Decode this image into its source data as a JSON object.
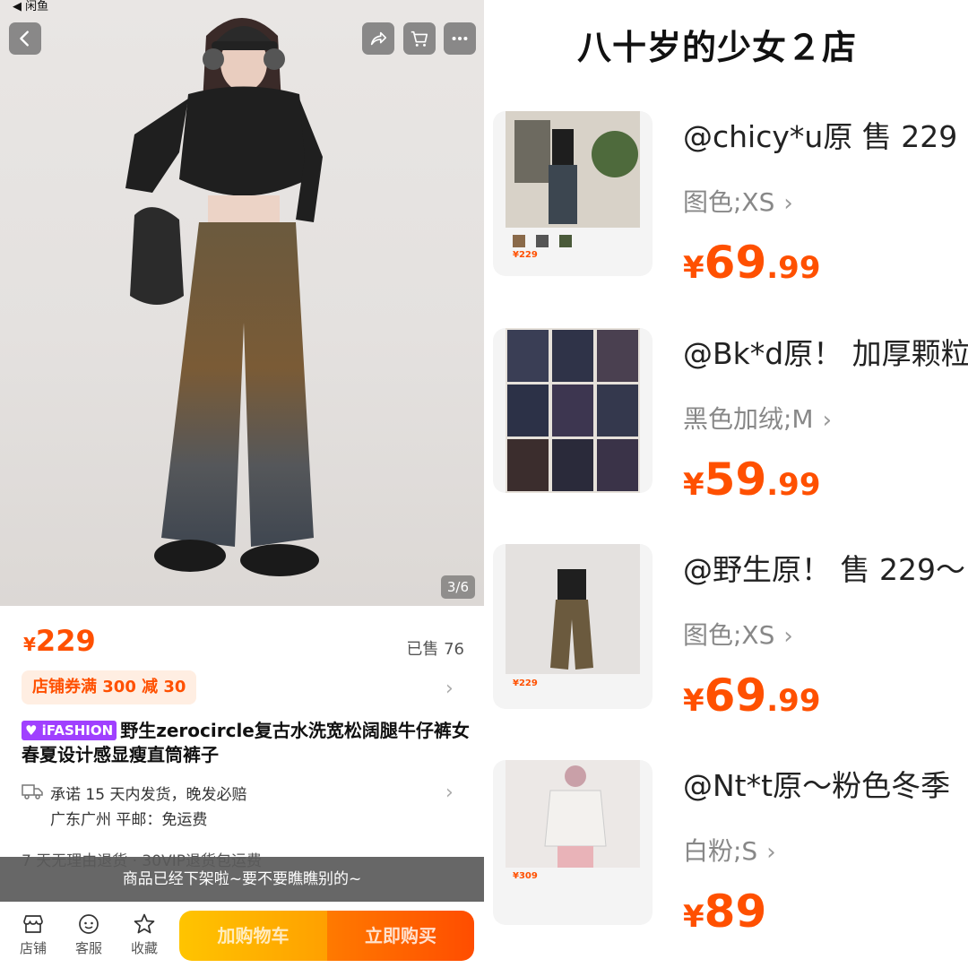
{
  "status_bar": {
    "back_app": "◀ 闲鱼"
  },
  "product": {
    "image_counter": "3/6",
    "price_currency": "¥",
    "price": "229",
    "sold": "已售 76",
    "coupon": "店铺券满 300 减 30",
    "badge": "iFASHION",
    "title": "野生zerocircle复古水洗宽松阔腿牛仔裤女春夏设计感显瘦直筒裤子",
    "shipping_line1": "承诺 15 天内发货，晚发必赔",
    "shipping_line2": "广东广州  平邮：免运费",
    "service_line": "7 天无理由退货 · 30VIP退货包运费",
    "offline_notice": "商品已经下架啦~要不要瞧瞧别的~"
  },
  "bottom_bar": {
    "store": "店铺",
    "service": "客服",
    "favorite": "收藏",
    "add_to_cart": "加购物车",
    "buy_now": "立即购买"
  },
  "right_panel": {
    "shop_title": "八十岁的少女２店",
    "items": [
      {
        "title": "@chicy*u原 售 229",
        "spec": "图色;XS",
        "currency": "¥",
        "price_int": "69",
        "price_dec": ".99",
        "thumb_price": "¥229"
      },
      {
        "title": "@Bk*d原！ 加厚颗粒",
        "spec": "黑色加绒;M",
        "currency": "¥",
        "price_int": "59",
        "price_dec": ".99",
        "thumb_price": ""
      },
      {
        "title": "@野生原！ 售 229～",
        "spec": "图色;XS",
        "currency": "¥",
        "price_int": "69",
        "price_dec": ".99",
        "thumb_price": "¥229"
      },
      {
        "title": "@Nt*t原～粉色冬季",
        "spec": "白粉;S",
        "currency": "¥",
        "price_int": "89",
        "price_dec": "",
        "thumb_price": "¥309"
      }
    ]
  },
  "colors": {
    "accent": "#ff5000",
    "coupon_bg": "#ffeee2",
    "badge": "#a040ff"
  }
}
